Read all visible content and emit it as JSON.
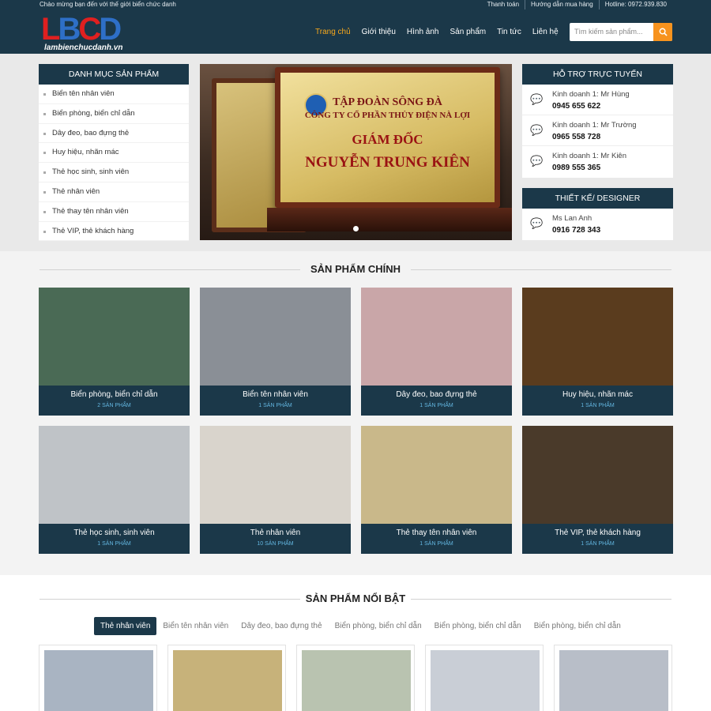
{
  "topbar": {
    "welcome": "Chào mừng bạn đến với thế giới biển chức danh",
    "links": [
      "Thanh toán",
      "Hướng dẫn mua hàng",
      "Hotline: 0972.939.830"
    ]
  },
  "header": {
    "logo_letters": [
      "L",
      "B",
      "C",
      "D"
    ],
    "logo_site": "lambienchucdanh.vn",
    "nav": [
      "Trang chủ",
      "Giới thiệu",
      "Hình ảnh",
      "Sản phẩm",
      "Tin tức",
      "Liên hệ"
    ],
    "search_placeholder": "Tìm kiếm sản phẩm..."
  },
  "categories": {
    "title": "Danh mục sản phẩm",
    "items": [
      "Biển tên nhân viên",
      "Biển phòng, biển chỉ dẫn",
      "Dây đeo, bao đựng thẻ",
      "Huy hiệu, nhãn mác",
      "Thẻ học sinh, sinh viên",
      "Thẻ nhân viên",
      "Thẻ thay tên nhân viên",
      "Thẻ VIP, thẻ khách hàng"
    ]
  },
  "slider": {
    "org": "TẬP ĐOÀN SÔNG ĐÀ",
    "company": "CÔNG TY CỔ PHẦN THỦY ĐIỆN NÀ LỢI",
    "role": "GIÁM ĐỐC",
    "name": "NGUYỄN TRUNG KIÊN"
  },
  "support": {
    "title": "Hỗ trợ trực tuyến",
    "contacts": [
      {
        "label": "Kinh doanh 1: Mr Hùng",
        "phone": "0945 655 622"
      },
      {
        "label": "Kinh doanh 1: Mr Trường",
        "phone": "0965 558 728"
      },
      {
        "label": "Kinh doanh 1: Mr Kiên",
        "phone": "0989 555 365"
      }
    ]
  },
  "designer": {
    "title": "Thiết kế/ Designer",
    "label": "Ms Lan Anh",
    "phone": "0916 728 343"
  },
  "main_products": {
    "title": "Sản phẩm chính",
    "items": [
      {
        "name": "Biển phòng, biển chỉ dẫn",
        "count": "2 SẢN PHẨM",
        "color": "#4a6a55"
      },
      {
        "name": "Biển tên nhân viên",
        "count": "1 SẢN PHẨM",
        "color": "#8a8f96"
      },
      {
        "name": "Dây đeo, bao đựng thẻ",
        "count": "1 SẢN PHẨM",
        "color": "#c9a6a8"
      },
      {
        "name": "Huy hiệu, nhãn mác",
        "count": "1 SẢN PHẨM",
        "color": "#5a3c1e"
      },
      {
        "name": "Thẻ học sinh, sinh viên",
        "count": "1 SẢN PHẨM",
        "color": "#bfc3c7"
      },
      {
        "name": "Thẻ nhân viên",
        "count": "10 SẢN PHẨM",
        "color": "#d9d4cc"
      },
      {
        "name": "Thẻ thay tên nhân viên",
        "count": "1 SẢN PHẨM",
        "color": "#c9b88a"
      },
      {
        "name": "Thẻ VIP, thẻ khách hàng",
        "count": "1 SẢN PHẨM",
        "color": "#4a3a2a"
      }
    ]
  },
  "featured": {
    "title": "Sản phẩm nổi bật",
    "tabs": [
      "Thẻ nhân viên",
      "Biển tên nhân viên",
      "Dây đeo, bao đựng thẻ",
      "Biển phòng, biển chỉ dẫn",
      "Biển phòng, biển chỉ dẫn",
      "Biển phòng, biển chỉ dẫn"
    ],
    "active_tab": 0,
    "cards": 5
  },
  "colors": {
    "navy": "#1b3849",
    "accent": "#f7a81b",
    "search_button": "#f7931e"
  }
}
